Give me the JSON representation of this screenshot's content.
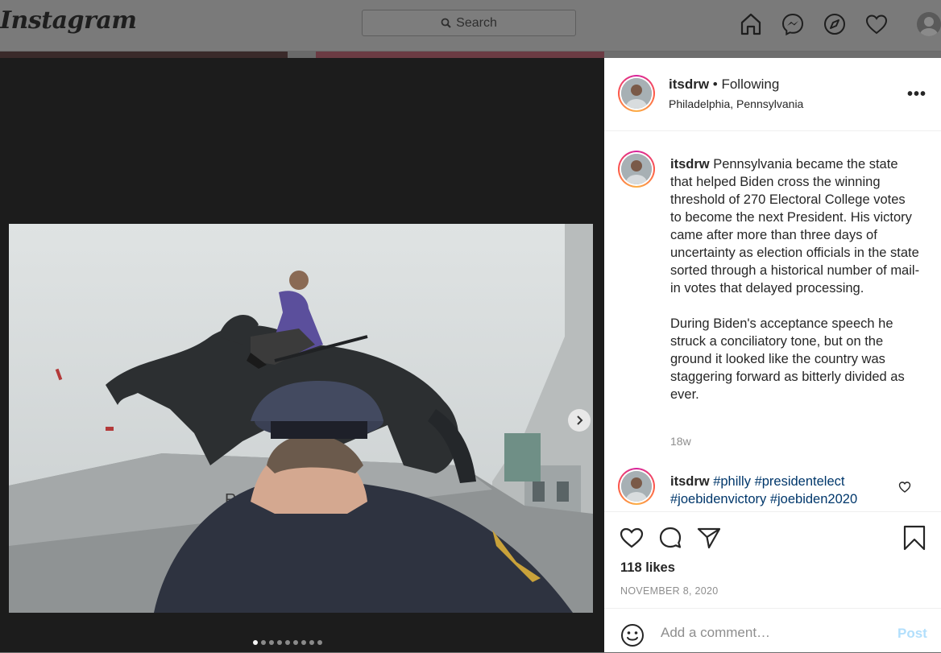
{
  "topbar": {
    "logo": "Instagram",
    "search_placeholder": "Search",
    "icons": [
      "home-icon",
      "messenger-icon",
      "explore-icon",
      "activity-heart-icon",
      "profile-avatar"
    ]
  },
  "post": {
    "username": "itsdrw",
    "follow_status": "• Following",
    "location": "Philadelphia, Pennsylvania",
    "more_label": "•••",
    "caption_user": "itsdrw",
    "caption": "Pennsylvania became the state that helped Biden cross the winning threshold of 270 Electoral College votes to become the next President. His victory came after more than three days of uncertainty as election officials in the state sorted through a historical number of mail-in votes that delayed processing.\n\nDuring Biden's acceptance speech he struck a conciliatory tone, but on the ground it looked like the country was staggering forward as bitterly divided as ever.",
    "caption_time": "18w",
    "comment2_user": "itsdrw",
    "comment2_tags": [
      "#philly",
      "#presidentelect",
      "#joebidenvictory",
      "#joebiden2020"
    ],
    "likes": "118 likes",
    "date": "NOVEMBER 8, 2020",
    "comment_placeholder": "Add a comment…",
    "post_label": "Post",
    "photo_text": "REY",
    "carousel": {
      "total": 9,
      "active": 1
    }
  },
  "colors": {
    "link": "#00376b",
    "post_button": "#b2dffc",
    "muted": "#8e8e8e"
  }
}
